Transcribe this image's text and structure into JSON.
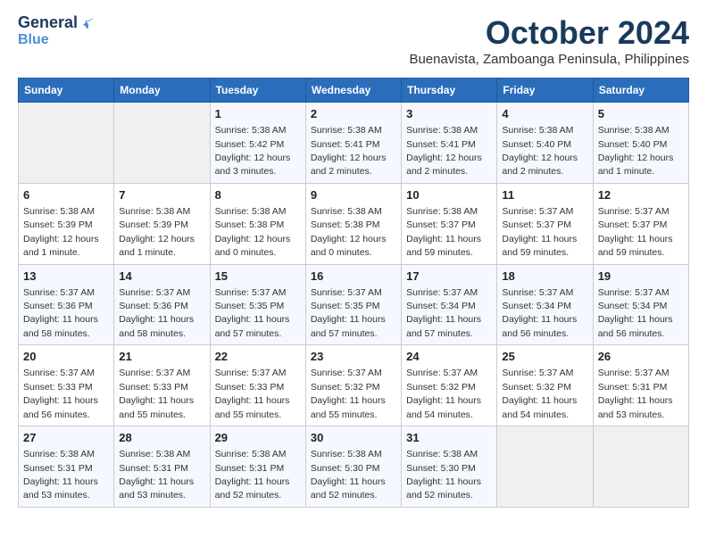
{
  "header": {
    "logo_line1": "General",
    "logo_line2": "Blue",
    "month": "October 2024",
    "location": "Buenavista, Zamboanga Peninsula, Philippines"
  },
  "weekdays": [
    "Sunday",
    "Monday",
    "Tuesday",
    "Wednesday",
    "Thursday",
    "Friday",
    "Saturday"
  ],
  "weeks": [
    [
      {
        "day": "",
        "sunrise": "",
        "sunset": "",
        "daylight": ""
      },
      {
        "day": "",
        "sunrise": "",
        "sunset": "",
        "daylight": ""
      },
      {
        "day": "1",
        "sunrise": "Sunrise: 5:38 AM",
        "sunset": "Sunset: 5:42 PM",
        "daylight": "Daylight: 12 hours and 3 minutes."
      },
      {
        "day": "2",
        "sunrise": "Sunrise: 5:38 AM",
        "sunset": "Sunset: 5:41 PM",
        "daylight": "Daylight: 12 hours and 2 minutes."
      },
      {
        "day": "3",
        "sunrise": "Sunrise: 5:38 AM",
        "sunset": "Sunset: 5:41 PM",
        "daylight": "Daylight: 12 hours and 2 minutes."
      },
      {
        "day": "4",
        "sunrise": "Sunrise: 5:38 AM",
        "sunset": "Sunset: 5:40 PM",
        "daylight": "Daylight: 12 hours and 2 minutes."
      },
      {
        "day": "5",
        "sunrise": "Sunrise: 5:38 AM",
        "sunset": "Sunset: 5:40 PM",
        "daylight": "Daylight: 12 hours and 1 minute."
      }
    ],
    [
      {
        "day": "6",
        "sunrise": "Sunrise: 5:38 AM",
        "sunset": "Sunset: 5:39 PM",
        "daylight": "Daylight: 12 hours and 1 minute."
      },
      {
        "day": "7",
        "sunrise": "Sunrise: 5:38 AM",
        "sunset": "Sunset: 5:39 PM",
        "daylight": "Daylight: 12 hours and 1 minute."
      },
      {
        "day": "8",
        "sunrise": "Sunrise: 5:38 AM",
        "sunset": "Sunset: 5:38 PM",
        "daylight": "Daylight: 12 hours and 0 minutes."
      },
      {
        "day": "9",
        "sunrise": "Sunrise: 5:38 AM",
        "sunset": "Sunset: 5:38 PM",
        "daylight": "Daylight: 12 hours and 0 minutes."
      },
      {
        "day": "10",
        "sunrise": "Sunrise: 5:38 AM",
        "sunset": "Sunset: 5:37 PM",
        "daylight": "Daylight: 11 hours and 59 minutes."
      },
      {
        "day": "11",
        "sunrise": "Sunrise: 5:37 AM",
        "sunset": "Sunset: 5:37 PM",
        "daylight": "Daylight: 11 hours and 59 minutes."
      },
      {
        "day": "12",
        "sunrise": "Sunrise: 5:37 AM",
        "sunset": "Sunset: 5:37 PM",
        "daylight": "Daylight: 11 hours and 59 minutes."
      }
    ],
    [
      {
        "day": "13",
        "sunrise": "Sunrise: 5:37 AM",
        "sunset": "Sunset: 5:36 PM",
        "daylight": "Daylight: 11 hours and 58 minutes."
      },
      {
        "day": "14",
        "sunrise": "Sunrise: 5:37 AM",
        "sunset": "Sunset: 5:36 PM",
        "daylight": "Daylight: 11 hours and 58 minutes."
      },
      {
        "day": "15",
        "sunrise": "Sunrise: 5:37 AM",
        "sunset": "Sunset: 5:35 PM",
        "daylight": "Daylight: 11 hours and 57 minutes."
      },
      {
        "day": "16",
        "sunrise": "Sunrise: 5:37 AM",
        "sunset": "Sunset: 5:35 PM",
        "daylight": "Daylight: 11 hours and 57 minutes."
      },
      {
        "day": "17",
        "sunrise": "Sunrise: 5:37 AM",
        "sunset": "Sunset: 5:34 PM",
        "daylight": "Daylight: 11 hours and 57 minutes."
      },
      {
        "day": "18",
        "sunrise": "Sunrise: 5:37 AM",
        "sunset": "Sunset: 5:34 PM",
        "daylight": "Daylight: 11 hours and 56 minutes."
      },
      {
        "day": "19",
        "sunrise": "Sunrise: 5:37 AM",
        "sunset": "Sunset: 5:34 PM",
        "daylight": "Daylight: 11 hours and 56 minutes."
      }
    ],
    [
      {
        "day": "20",
        "sunrise": "Sunrise: 5:37 AM",
        "sunset": "Sunset: 5:33 PM",
        "daylight": "Daylight: 11 hours and 56 minutes."
      },
      {
        "day": "21",
        "sunrise": "Sunrise: 5:37 AM",
        "sunset": "Sunset: 5:33 PM",
        "daylight": "Daylight: 11 hours and 55 minutes."
      },
      {
        "day": "22",
        "sunrise": "Sunrise: 5:37 AM",
        "sunset": "Sunset: 5:33 PM",
        "daylight": "Daylight: 11 hours and 55 minutes."
      },
      {
        "day": "23",
        "sunrise": "Sunrise: 5:37 AM",
        "sunset": "Sunset: 5:32 PM",
        "daylight": "Daylight: 11 hours and 55 minutes."
      },
      {
        "day": "24",
        "sunrise": "Sunrise: 5:37 AM",
        "sunset": "Sunset: 5:32 PM",
        "daylight": "Daylight: 11 hours and 54 minutes."
      },
      {
        "day": "25",
        "sunrise": "Sunrise: 5:37 AM",
        "sunset": "Sunset: 5:32 PM",
        "daylight": "Daylight: 11 hours and 54 minutes."
      },
      {
        "day": "26",
        "sunrise": "Sunrise: 5:37 AM",
        "sunset": "Sunset: 5:31 PM",
        "daylight": "Daylight: 11 hours and 53 minutes."
      }
    ],
    [
      {
        "day": "27",
        "sunrise": "Sunrise: 5:38 AM",
        "sunset": "Sunset: 5:31 PM",
        "daylight": "Daylight: 11 hours and 53 minutes."
      },
      {
        "day": "28",
        "sunrise": "Sunrise: 5:38 AM",
        "sunset": "Sunset: 5:31 PM",
        "daylight": "Daylight: 11 hours and 53 minutes."
      },
      {
        "day": "29",
        "sunrise": "Sunrise: 5:38 AM",
        "sunset": "Sunset: 5:31 PM",
        "daylight": "Daylight: 11 hours and 52 minutes."
      },
      {
        "day": "30",
        "sunrise": "Sunrise: 5:38 AM",
        "sunset": "Sunset: 5:30 PM",
        "daylight": "Daylight: 11 hours and 52 minutes."
      },
      {
        "day": "31",
        "sunrise": "Sunrise: 5:38 AM",
        "sunset": "Sunset: 5:30 PM",
        "daylight": "Daylight: 11 hours and 52 minutes."
      },
      {
        "day": "",
        "sunrise": "",
        "sunset": "",
        "daylight": ""
      },
      {
        "day": "",
        "sunrise": "",
        "sunset": "",
        "daylight": ""
      }
    ]
  ]
}
